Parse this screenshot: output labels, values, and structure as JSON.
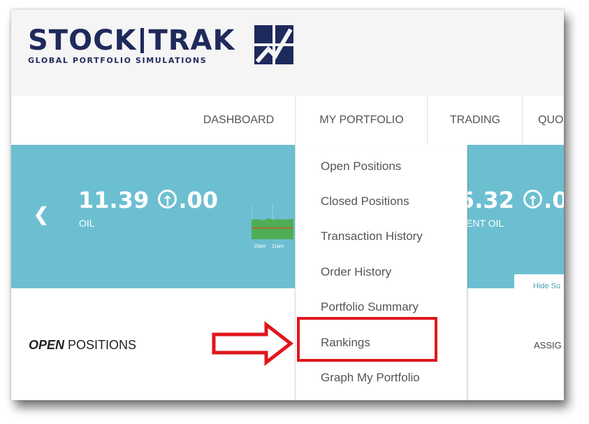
{
  "brand": {
    "name_left": "STOCK",
    "name_right": "TRAK",
    "tagline": "GLOBAL PORTFOLIO SIMULATIONS"
  },
  "nav": {
    "dashboard": "DASHBOARD",
    "my_portfolio": "MY PORTFOLIO",
    "trading": "TRADING",
    "quotes_partial": "QUO"
  },
  "dropdown": {
    "items": [
      "Open Positions",
      "Closed Positions",
      "Transaction History",
      "Order History",
      "Portfolio Summary",
      "Rankings",
      "Graph My Portfolio"
    ],
    "highlighted": "Rankings"
  },
  "ticker": {
    "prev_icon": "chevron-left-icon",
    "items": [
      {
        "value": "11.39",
        "change": ".00",
        "name": "OIL",
        "direction_icon": "arrow-up-circle-icon"
      },
      {
        "value": "5.32",
        "change": ".0",
        "name": "ENT OIL",
        "direction_icon": "arrow-up-circle-icon"
      }
    ],
    "spark_labels": [
      "10am",
      "11am"
    ],
    "hide_button": "Hide Su"
  },
  "content": {
    "title_bold": "OPEN",
    "title_rest": " POSITIONS",
    "right_partial": "ASSIG"
  },
  "colors": {
    "brand_navy": "#1f2a5c",
    "ticker_bg": "#6cbfd1",
    "highlight_red": "#e0161c"
  }
}
